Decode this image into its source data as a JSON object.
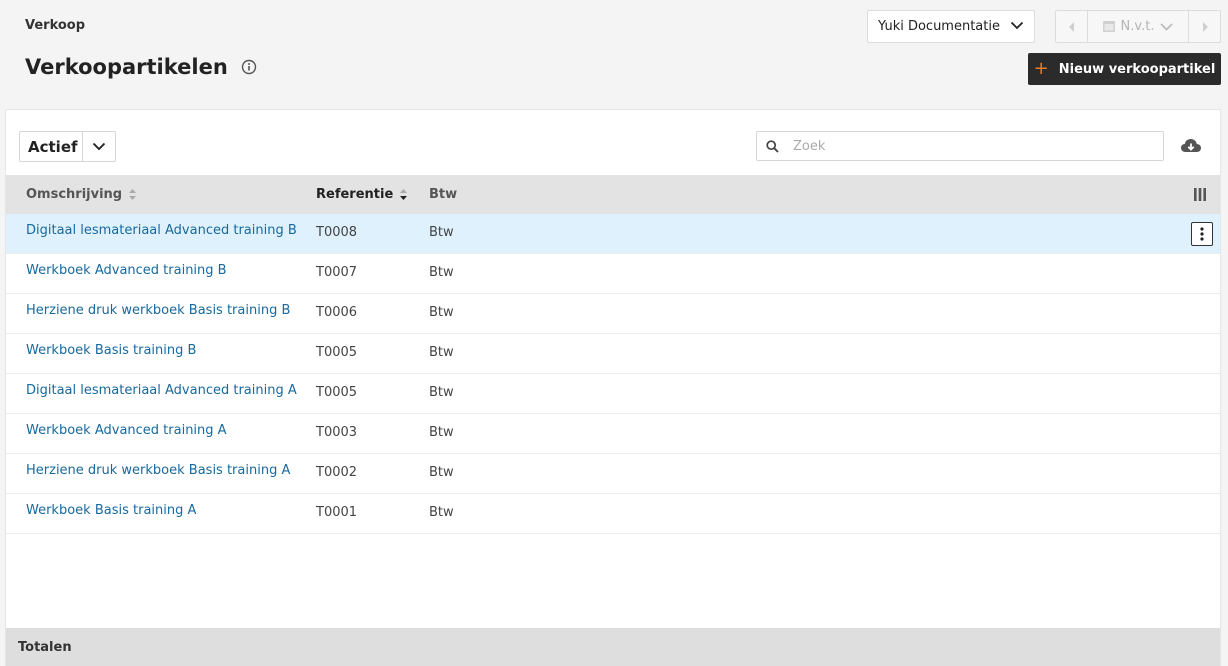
{
  "header": {
    "breadcrumb": "Verkoop",
    "title": "Verkoopartikelen",
    "info_icon": "info-circle-icon"
  },
  "administration": {
    "selected": "Yuki Documentatie"
  },
  "period": {
    "label": "N.v.t."
  },
  "actions": {
    "new_item_label": "Nieuw verkoopartikel"
  },
  "filter": {
    "status_selected": "Actief"
  },
  "search": {
    "placeholder": "Zoek",
    "value": ""
  },
  "table": {
    "columns": [
      {
        "key": "description",
        "label": "Omschrijving",
        "sort": "none"
      },
      {
        "key": "reference",
        "label": "Referentie",
        "sort": "desc"
      },
      {
        "key": "vat",
        "label": "Btw"
      }
    ],
    "rows": [
      {
        "description": "Digitaal lesmateriaal Advanced training B",
        "reference": "T0008",
        "vat": "Btw",
        "selected": true
      },
      {
        "description": "Werkboek Advanced training B",
        "reference": "T0007",
        "vat": "Btw"
      },
      {
        "description": "Herziene druk werkboek Basis training B",
        "reference": "T0006",
        "vat": "Btw"
      },
      {
        "description": "Werkboek Basis training B",
        "reference": "T0005",
        "vat": "Btw"
      },
      {
        "description": "Digitaal lesmateriaal Advanced training A",
        "reference": "T0005",
        "vat": "Btw"
      },
      {
        "description": "Werkboek Advanced training A",
        "reference": "T0003",
        "vat": "Btw"
      },
      {
        "description": "Herziene druk werkboek Basis training A",
        "reference": "T0002",
        "vat": "Btw"
      },
      {
        "description": "Werkboek Basis training A",
        "reference": "T0001",
        "vat": "Btw"
      }
    ],
    "totals_label": "Totalen"
  },
  "colors": {
    "link": "#17699e",
    "selected_row": "#dff1fc",
    "primary_button": "#2b2b2b",
    "accent": "#f07b22"
  }
}
